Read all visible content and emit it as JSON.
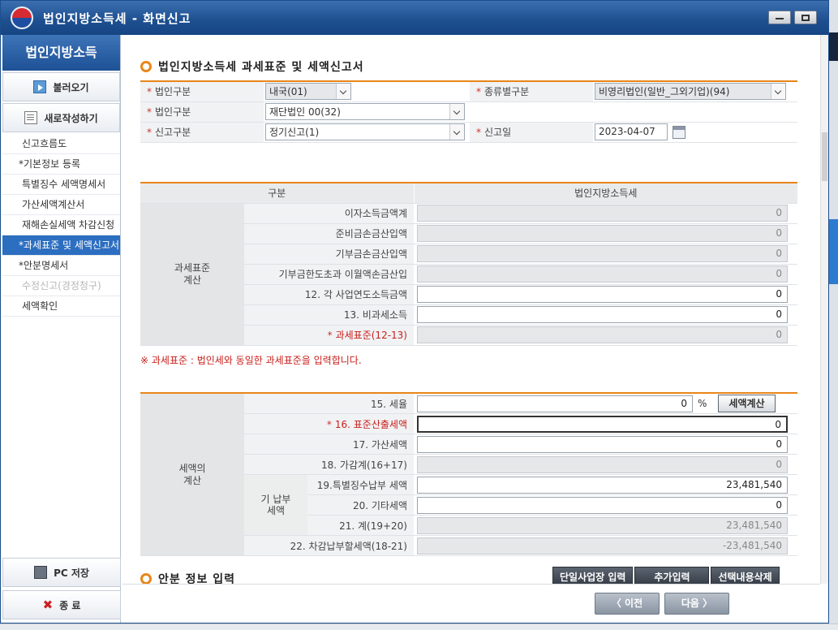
{
  "window": {
    "title": "법인지방소득세 - 화면신고"
  },
  "nav": {
    "header": "법인지방소득",
    "load_button": "불러오기",
    "new_button": "새로작성하기",
    "items": [
      {
        "label": "신고흐름도"
      },
      {
        "label": "*기본정보 등록"
      },
      {
        "label": "특별징수 세액명세서"
      },
      {
        "label": "가산세액계산서"
      },
      {
        "label": "재해손실세액 차감신청"
      },
      {
        "label": "*과세표준 및 세액신고서"
      },
      {
        "label": "*안분명세서"
      },
      {
        "label": "수정신고(경정청구)"
      },
      {
        "label": "세액확인"
      }
    ],
    "save_button": "PC 저장",
    "exit_button": "종 료"
  },
  "main": {
    "section_title": "법인지방소득세 과세표준 및 세액신고서",
    "form": {
      "corp_type_label": "법인구분",
      "corp_type_value": "내국(01)",
      "kind_label": "종류별구분",
      "kind_value": "비영리법인(일반_그외기업)(94)",
      "corp_type2_label": "법인구분",
      "corp_type2_value": "재단법인 00(32)",
      "report_type_label": "신고구분",
      "report_type_value": "정기신고(1)",
      "report_date_label": "신고일",
      "report_date_value": "2023-04-07"
    },
    "tax_base": {
      "col_category": "구분",
      "col_tax": "법인지방소득세",
      "group_label": "과세표준\n계산",
      "rows": [
        {
          "label": "이자소득금액계",
          "value": "0"
        },
        {
          "label": "준비금손금산입액",
          "value": "0"
        },
        {
          "label": "기부금손금산입액",
          "value": "0"
        },
        {
          "label": "기부금한도초과 이월액손금산입",
          "value": "0"
        },
        {
          "label": "12. 각 사업연도소득금액",
          "value": "0"
        },
        {
          "label": "13. 비과세소득",
          "value": "0"
        },
        {
          "label": "과세표준(12-13)",
          "value": "0"
        }
      ],
      "note": "※ 과세표준 : 법인세와 동일한 과세표준을 입력합니다."
    },
    "tax_calc": {
      "group_label": "세액의\n계산",
      "rate_label": "15. 세율",
      "rate_value": "0",
      "rate_unit": "%",
      "calc_button": "세액계산",
      "standard_label": "16. 표준산출세액",
      "standard_value": "0",
      "surcharge_label": "17. 가산세액",
      "surcharge_value": "0",
      "sum_label": "18. 가감계(16+17)",
      "sum_value": "0",
      "prepaid_group": "기 납부\n세액",
      "special_label": "19.특별징수납부 세액",
      "special_value": "23,481,540",
      "other_label": "20. 기타세액",
      "other_value": "0",
      "total_label": "21. 계(19+20)",
      "total_value": "23,481,540",
      "diff_label": "22. 차감납부할세액(18-21)",
      "diff_value": "-23,481,540"
    },
    "alloc_title": "안분 정보 입력",
    "alloc_buttons": {
      "single": "단일사업장 입력",
      "add": "추가입력",
      "delete": "선택내용삭제"
    },
    "footer": {
      "prev": "〈 이전",
      "next": "다음 〉"
    }
  }
}
